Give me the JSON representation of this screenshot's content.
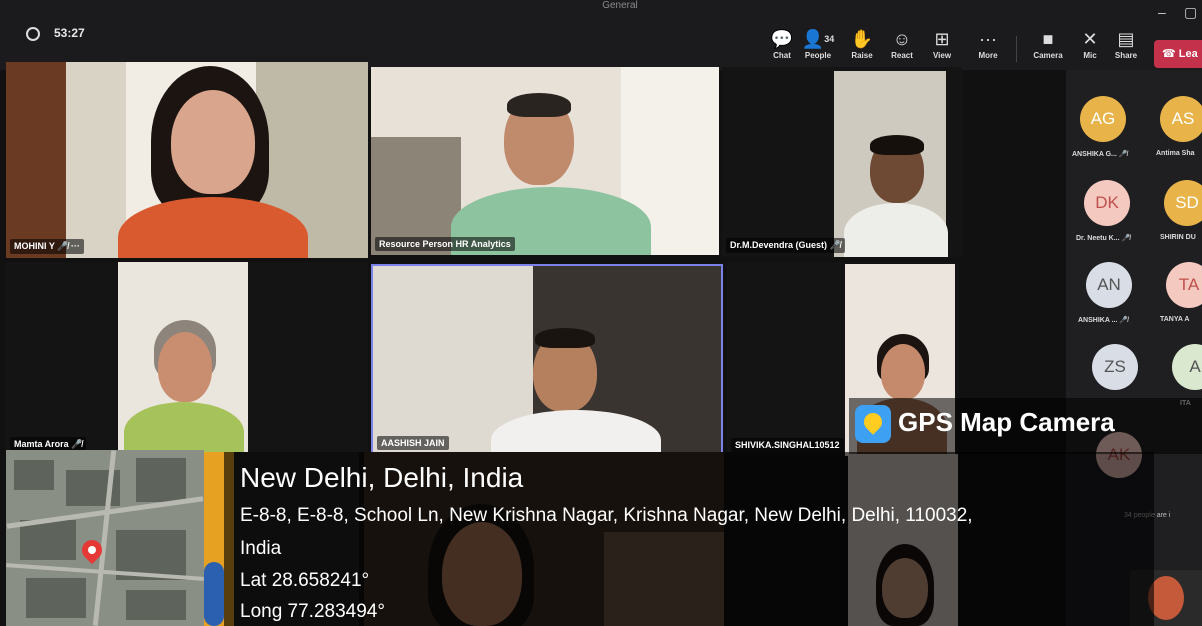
{
  "window": {
    "title": "General"
  },
  "toolbar": {
    "timer": "53:27",
    "people_count": "34",
    "buttons": [
      {
        "id": "chat",
        "label": "Chat",
        "icon": "chat-icon",
        "glyph": "💬"
      },
      {
        "id": "people",
        "label": "People",
        "icon": "people-icon",
        "glyph": "👤"
      },
      {
        "id": "raise",
        "label": "Raise",
        "icon": "raise-hand-icon",
        "glyph": "✋"
      },
      {
        "id": "react",
        "label": "React",
        "icon": "react-icon",
        "glyph": "☺"
      },
      {
        "id": "view",
        "label": "View",
        "icon": "view-icon",
        "glyph": "⊞"
      },
      {
        "id": "more",
        "label": "More",
        "icon": "more-icon",
        "glyph": "···"
      },
      {
        "id": "camera",
        "label": "Camera",
        "icon": "camera-icon",
        "glyph": "■"
      },
      {
        "id": "mic",
        "label": "Mic",
        "icon": "mic-off-icon",
        "glyph": "✕"
      },
      {
        "id": "share",
        "label": "Share",
        "icon": "share-icon",
        "glyph": "▤"
      }
    ],
    "leave_label": "Lea"
  },
  "tiles": [
    {
      "name": "MOHINI Y",
      "extra": "🎤̸ ···"
    },
    {
      "name": "Resource Person HR Analytics"
    },
    {
      "name": "Dr.M.Devendra (Guest)",
      "extra": "🎤̸"
    },
    {
      "name": "Mamta Arora",
      "extra": "🎤̸"
    },
    {
      "name": "AASHISH JAIN"
    },
    {
      "name": "SHIVIKA.SINGHAL10512"
    }
  ],
  "participants": [
    {
      "initials": "AG",
      "name": "ANSHIKA G... 🎤̸",
      "color": "#e8b44a",
      "text": "#fff"
    },
    {
      "initials": "AS",
      "name": "Antima Sha",
      "color": "#e8b44a",
      "text": "#fff"
    },
    {
      "initials": "DK",
      "name": "Dr. Neetu K... 🎤̸",
      "color": "#f4c9c0",
      "text": "#c0504d"
    },
    {
      "initials": "SD",
      "name": "SHIRIN DU",
      "color": "#e8b44a",
      "text": "#fff"
    },
    {
      "initials": "AN",
      "name": "ANSHIKA ... 🎤̸",
      "color": "#d9dde6",
      "text": "#555"
    },
    {
      "initials": "TA",
      "name": "TANYA A",
      "color": "#f4c9c0",
      "text": "#c0504d"
    },
    {
      "initials": "ZS",
      "name": "",
      "color": "#d9dde6",
      "text": "#555"
    },
    {
      "initials": "A",
      "name": "ITA",
      "color": "#d9e8cf",
      "text": "#555"
    },
    {
      "initials": "AK",
      "name": "",
      "color": "#f4c9c0",
      "text": "#c0504d"
    }
  ],
  "more_people": "34 people are i",
  "gps": {
    "brand": "GPS Map Camera",
    "city": "New Delhi, Delhi, India",
    "address_line1": "E-8-8, E-8-8, School Ln, New Krishna Nagar, Krishna Nagar, New Delhi, Delhi, 110032,",
    "address_line2": "India",
    "lat": "Lat 28.658241°",
    "long": "Long 77.283494°"
  }
}
